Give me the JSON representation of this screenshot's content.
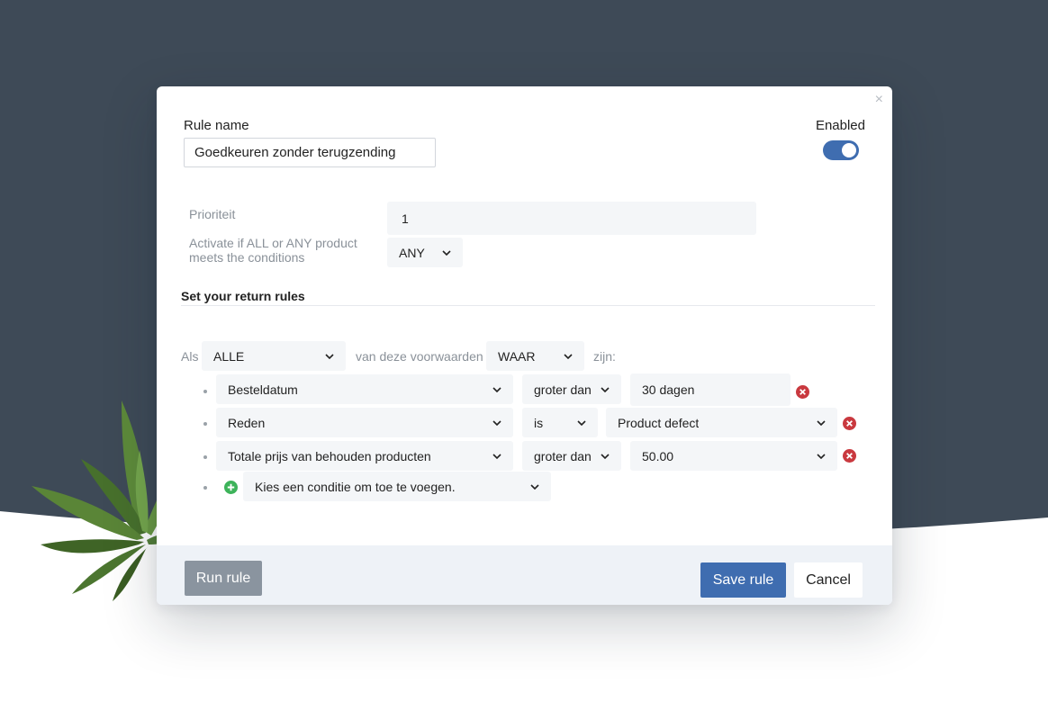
{
  "modal": {
    "close_glyph": "×",
    "rule_name_label": "Rule name",
    "rule_name_value": "Goedkeuren zonder terugzending",
    "enabled_label": "Enabled",
    "enabled": true
  },
  "settings": {
    "priority_label": "Prioriteit",
    "priority_value": "1",
    "activate_label": "Activate if ALL or ANY product meets the conditions",
    "activate_value": "ANY"
  },
  "rules": {
    "section_title": "Set your return rules",
    "als_label": "Als",
    "match_value": "ALLE",
    "middle_label": "van deze voorwaarden",
    "truth_value": "WAAR",
    "zijn_label": "zijn:",
    "conditions": [
      {
        "field": "Besteldatum",
        "operator": "groter dan",
        "value": "30 dagen",
        "value_type": "text"
      },
      {
        "field": "Reden",
        "operator": "is",
        "value": "Product defect",
        "value_type": "select"
      },
      {
        "field": "Totale prijs van behouden producten",
        "operator": "groter dan",
        "value": "50.00",
        "value_type": "select"
      }
    ],
    "add_placeholder": "Kies een conditie om toe te voegen."
  },
  "footer": {
    "run_label": "Run rule",
    "save_label": "Save rule",
    "cancel_label": "Cancel"
  },
  "colors": {
    "header_bg": "#3e4a57",
    "primary": "#3f6db0",
    "run_button": "#8a949f",
    "remove_icon": "#c9393f",
    "add_icon": "#3db35a",
    "footer_bg": "#eef2f7"
  },
  "icons": {
    "close": "close-icon",
    "select_arrow": "chevron-down-icon",
    "remove_condition": "remove-circle-icon",
    "add_condition": "add-circle-icon"
  }
}
